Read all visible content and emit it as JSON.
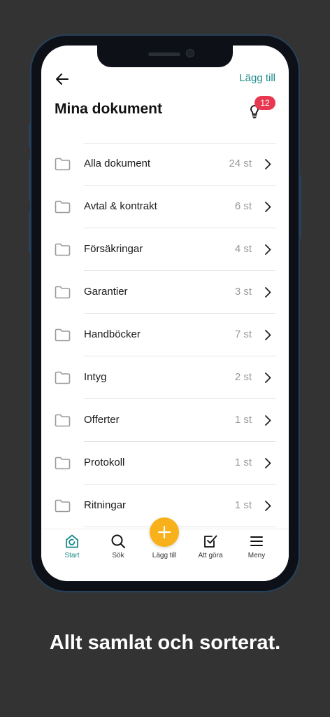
{
  "header": {
    "back_icon": "arrow-left-icon",
    "add_label": "Lägg till",
    "title": "Mina dokument",
    "notification_icon": "lightbulb-icon",
    "notification_count": "12"
  },
  "folders": [
    {
      "label": "Alla dokument",
      "count": "24 st"
    },
    {
      "label": "Avtal & kontrakt",
      "count": "6 st"
    },
    {
      "label": "Försäkringar",
      "count": "4 st"
    },
    {
      "label": "Garantier",
      "count": "3 st"
    },
    {
      "label": "Handböcker",
      "count": "7 st"
    },
    {
      "label": "Intyg",
      "count": "2 st"
    },
    {
      "label": "Offerter",
      "count": "1 st"
    },
    {
      "label": "Protokoll",
      "count": "1 st"
    },
    {
      "label": "Ritningar",
      "count": "1 st"
    }
  ],
  "tabbar": {
    "start": "Start",
    "search": "Sök",
    "add": "Lägg till",
    "todo": "Att göra",
    "menu": "Meny",
    "active": "start"
  },
  "caption": "Allt samlat och sorterat.",
  "colors": {
    "accent": "#1f8a8a",
    "fab": "#f8b11a",
    "badge": "#e8384f",
    "background": "#333333"
  }
}
